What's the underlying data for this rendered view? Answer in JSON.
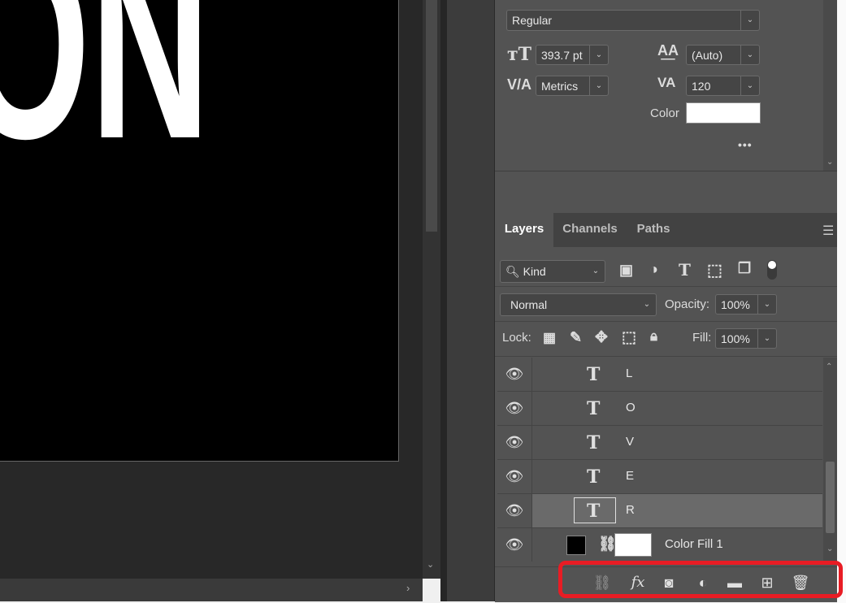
{
  "canvas": {
    "letters": "ION"
  },
  "character": {
    "font_style": "Regular",
    "font_size": "393.7 pt",
    "leading": "(Auto)",
    "kerning": "Metrics",
    "tracking": "120",
    "color_label": "Color",
    "color_value": "#ffffff",
    "more": "•••"
  },
  "tabs": [
    {
      "label": "Layers",
      "active": true
    },
    {
      "label": "Channels",
      "active": false
    },
    {
      "label": "Paths",
      "active": false
    }
  ],
  "filter": {
    "kind": "Kind"
  },
  "blend": {
    "mode": "Normal",
    "opacity_label": "Opacity:",
    "opacity": "100%"
  },
  "lock": {
    "label": "Lock:",
    "fill_label": "Fill:",
    "fill": "100%"
  },
  "layers": [
    {
      "name": "L",
      "type": "text"
    },
    {
      "name": "O",
      "type": "text"
    },
    {
      "name": "V",
      "type": "text"
    },
    {
      "name": "E",
      "type": "text"
    },
    {
      "name": "R",
      "type": "text",
      "selected": true
    },
    {
      "name": "Color Fill 1",
      "type": "fill"
    }
  ],
  "bottom_icons": [
    "link-icon",
    "fx-icon",
    "mask-icon",
    "adjustment-icon",
    "folder-icon",
    "new-layer-icon",
    "trash-icon"
  ],
  "colors": {
    "highlight": "#e81c24",
    "panel": "#535353"
  }
}
